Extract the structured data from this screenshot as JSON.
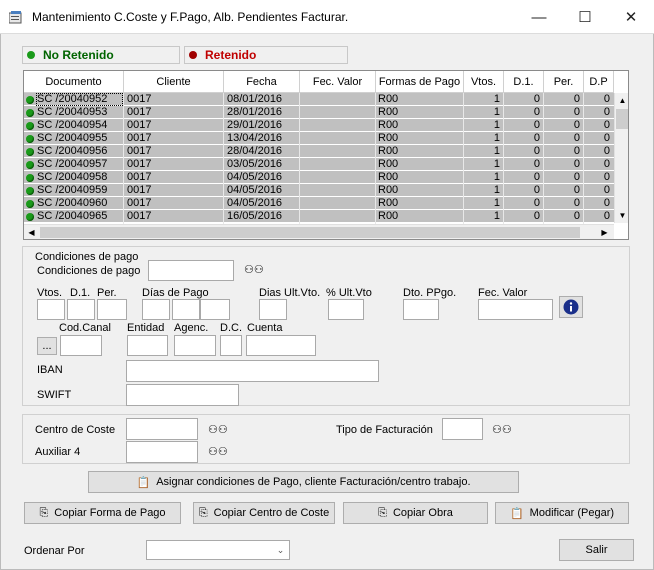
{
  "window": {
    "title": "Mantenimiento C.Coste y F.Pago, Alb. Pendientes Facturar.",
    "minimize_glyph": "—",
    "maximize_glyph": "☐",
    "close_glyph": "✕"
  },
  "legend": {
    "no_retenido": "No Retenido",
    "retenido": "Retenido",
    "no_retenido_color": "#1a9a1a",
    "retenido_color": "#a00000"
  },
  "grid": {
    "columns": [
      "Documento",
      "Cliente",
      "Fecha",
      "Fec. Valor",
      "Formas de Pago",
      "Vtos.",
      "D.1.",
      "Per.",
      "D.P"
    ],
    "rows": [
      {
        "doc": "SC /20040952",
        "cliente": "0017",
        "fecha": "08/01/2016",
        "fec_valor": "",
        "forma": "R00",
        "vtos": "1",
        "d1": "0",
        "per": "0",
        "dp": "0"
      },
      {
        "doc": "SC /20040953",
        "cliente": "0017",
        "fecha": "28/01/2016",
        "fec_valor": "",
        "forma": "R00",
        "vtos": "1",
        "d1": "0",
        "per": "0",
        "dp": "0"
      },
      {
        "doc": "SC /20040954",
        "cliente": "0017",
        "fecha": "29/01/2016",
        "fec_valor": "",
        "forma": "R00",
        "vtos": "1",
        "d1": "0",
        "per": "0",
        "dp": "0"
      },
      {
        "doc": "SC /20040955",
        "cliente": "0017",
        "fecha": "13/04/2016",
        "fec_valor": "",
        "forma": "R00",
        "vtos": "1",
        "d1": "0",
        "per": "0",
        "dp": "0"
      },
      {
        "doc": "SC /20040956",
        "cliente": "0017",
        "fecha": "28/04/2016",
        "fec_valor": "",
        "forma": "R00",
        "vtos": "1",
        "d1": "0",
        "per": "0",
        "dp": "0"
      },
      {
        "doc": "SC /20040957",
        "cliente": "0017",
        "fecha": "03/05/2016",
        "fec_valor": "",
        "forma": "R00",
        "vtos": "1",
        "d1": "0",
        "per": "0",
        "dp": "0"
      },
      {
        "doc": "SC /20040958",
        "cliente": "0017",
        "fecha": "04/05/2016",
        "fec_valor": "",
        "forma": "R00",
        "vtos": "1",
        "d1": "0",
        "per": "0",
        "dp": "0"
      },
      {
        "doc": "SC /20040959",
        "cliente": "0017",
        "fecha": "04/05/2016",
        "fec_valor": "",
        "forma": "R00",
        "vtos": "1",
        "d1": "0",
        "per": "0",
        "dp": "0"
      },
      {
        "doc": "SC /20040960",
        "cliente": "0017",
        "fecha": "04/05/2016",
        "fec_valor": "",
        "forma": "R00",
        "vtos": "1",
        "d1": "0",
        "per": "0",
        "dp": "0"
      },
      {
        "doc": "SC /20040965",
        "cliente": "0017",
        "fecha": "16/05/2016",
        "fec_valor": "",
        "forma": "R00",
        "vtos": "1",
        "d1": "0",
        "per": "0",
        "dp": "0"
      }
    ]
  },
  "condiciones": {
    "section_title": "Condiciones de pago",
    "condiciones_label": "Condiciones de pago",
    "vtos_label": "Vtos.",
    "d1_label": "D.1.",
    "per_label": "Per.",
    "dias_pago_label": "Días de Pago",
    "dias_ult_vto_label": "Dias Ult.Vto.",
    "pct_ult_vto_label": "% Ult.Vto",
    "dto_ppgo_label": "Dto. PPgo.",
    "fec_valor_label": "Fec. Valor",
    "cod_canal_label": "Cod.Canal",
    "entidad_label": "Entidad",
    "agenc_label": "Agenc.",
    "dc_label": "D.C.",
    "cuenta_label": "Cuenta",
    "iban_label": "IBAN",
    "swift_label": "SWIFT",
    "ellipsis_label": "..."
  },
  "coste": {
    "centro_coste_label": "Centro de Coste",
    "auxiliar_label": "Auxiliar 4",
    "tipo_facturacion_label": "Tipo de Facturación"
  },
  "buttons": {
    "asignar": "Asignar condiciones de Pago, cliente Facturación/centro trabajo.",
    "copiar_forma": "Copiar Forma de Pago",
    "copiar_centro": "Copiar Centro de Coste",
    "copiar_obra": "Copiar Obra",
    "modificar": "Modificar (Pegar)",
    "salir": "Salir"
  },
  "ordenar": {
    "label": "Ordenar Por",
    "value": ""
  }
}
